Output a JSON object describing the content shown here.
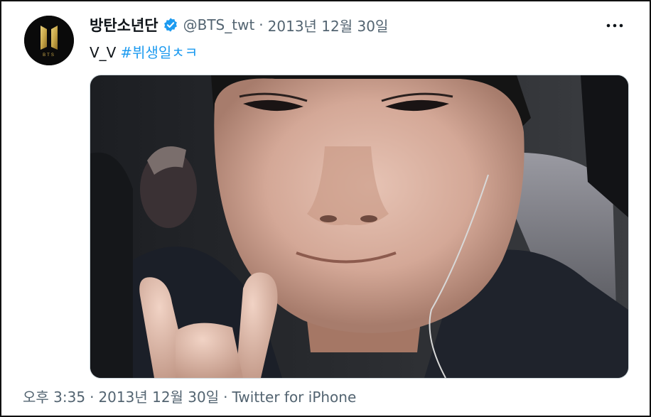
{
  "tweet": {
    "author_name": "방탄소년단",
    "handle": "@BTS_twt",
    "separator": "·",
    "date": "2013년 12월 30일",
    "more_icon": "more-horizontal-icon",
    "verified_icon": "verified-badge-icon",
    "text": "V_V",
    "hashtag": "#뷔생일ㅊㅋ",
    "avatar_label": "BTS",
    "media_alt": "selfie photo",
    "footer": {
      "time": "오후 3:35",
      "date": "2013년 12월 30일",
      "source": "Twitter for iPhone"
    }
  },
  "colors": {
    "text": "#0f1419",
    "secondary": "#536471",
    "link": "#1d9bf0",
    "verified": "#1d9bf0",
    "logo_gold": "#c9a84a"
  }
}
